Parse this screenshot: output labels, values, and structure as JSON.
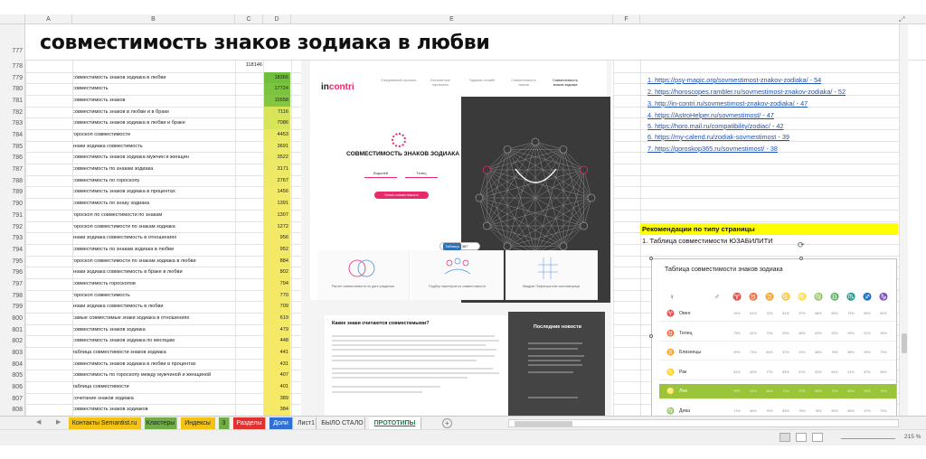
{
  "columns": [
    "A",
    "B",
    "C",
    "D",
    "E",
    "F"
  ],
  "title_row": {
    "num": "777",
    "title": "совместимость знаков зодиака в любви"
  },
  "total": "118146",
  "rows": [
    {
      "n": "778",
      "kw": "",
      "v": "",
      "c": ""
    },
    {
      "n": "779",
      "kw": "совместимость знаков зодиака в любви",
      "v": "18366",
      "c": "#6fbf3c"
    },
    {
      "n": "780",
      "kw": "совместимость",
      "v": "17724",
      "c": "#7cc33f"
    },
    {
      "n": "781",
      "kw": "совместимость знаков",
      "v": "15558",
      "c": "#84c642"
    },
    {
      "n": "782",
      "kw": "совместимость знаков в любви и в браке",
      "v": "7116",
      "c": "#d8e45a"
    },
    {
      "n": "783",
      "kw": "совместимость знаков зодиака в любви и браке",
      "v": "7086",
      "c": "#d8e45a"
    },
    {
      "n": "784",
      "kw": "гороскоп совместимости",
      "v": "4453",
      "c": "#e8e862"
    },
    {
      "n": "785",
      "kw": "знаки зодиака совместимость",
      "v": "3691",
      "c": "#ebe966"
    },
    {
      "n": "786",
      "kw": "совместимость знаков зодиака мужчин и женщин",
      "v": "3522",
      "c": "#ece966"
    },
    {
      "n": "787",
      "kw": "совместимость по знакам зодиака",
      "v": "3171",
      "c": "#ede966"
    },
    {
      "n": "788",
      "kw": "совместимость по гороскопу",
      "v": "2767",
      "c": "#eee966"
    },
    {
      "n": "789",
      "kw": "совместимость знаков зодиака в процентах",
      "v": "1456",
      "c": "#f1e967"
    },
    {
      "n": "790",
      "kw": "совместимость по знаку зодиака",
      "v": "1391",
      "c": "#f2e967"
    },
    {
      "n": "791",
      "kw": "гороскоп по совместимости по знакам",
      "v": "1307",
      "c": "#f2e967"
    },
    {
      "n": "792",
      "kw": "гороскоп совместимости по знакам зодиака",
      "v": "1272",
      "c": "#f2e967"
    },
    {
      "n": "793",
      "kw": "знаки зодиака совместимость в отношениях",
      "v": "956",
      "c": "#f3e967"
    },
    {
      "n": "794",
      "kw": "совместимость по знакам зодиака в любви",
      "v": "952",
      "c": "#f3e967"
    },
    {
      "n": "795",
      "kw": "гороскоп совместимости по знакам зодиака в любви",
      "v": "884",
      "c": "#f3e967"
    },
    {
      "n": "796",
      "kw": "знаки зодиака совместимость в браке в любви",
      "v": "802",
      "c": "#f4e967"
    },
    {
      "n": "797",
      "kw": "совместимость гороскопов",
      "v": "794",
      "c": "#f4e967"
    },
    {
      "n": "798",
      "kw": "гороскоп совместимость",
      "v": "770",
      "c": "#f4e967"
    },
    {
      "n": "799",
      "kw": "знаки зодиака совместимость в любви",
      "v": "709",
      "c": "#f4e967"
    },
    {
      "n": "800",
      "kw": "самые совместимые знаки зодиака в отношениях",
      "v": "619",
      "c": "#f4e967"
    },
    {
      "n": "801",
      "kw": "совместимость знаков зодиака",
      "v": "479",
      "c": "#f5e967"
    },
    {
      "n": "802",
      "kw": "совместимость знаков зодиака по месяцам",
      "v": "448",
      "c": "#f5e967"
    },
    {
      "n": "803",
      "kw": "таблица совместимости знаков зодиака",
      "v": "441",
      "c": "#f5e967"
    },
    {
      "n": "804",
      "kw": "совместимость знаков зодиака в любви в процентах",
      "v": "431",
      "c": "#f5e967"
    },
    {
      "n": "805",
      "kw": "совместимость по гороскопу между мужчиной и женщиной",
      "v": "407",
      "c": "#f5e967"
    },
    {
      "n": "806",
      "kw": "таблица совместимости",
      "v": "401",
      "c": "#f5e967"
    },
    {
      "n": "807",
      "kw": "сочетание знаков зодиака",
      "v": "389",
      "c": "#f5e967"
    },
    {
      "n": "808",
      "kw": "совместимость знаков зодиаков",
      "v": "384",
      "c": "#f5e967"
    }
  ],
  "links": [
    "1. https://psy-magic.org/sovmestimost-znakov-zodiaka/ - 54",
    "2. https://horoscopes.rambler.ru/sovmestimost-znakov-zodiaka/ - 52",
    "3. http://in-contri.ru/sovmestimost-znakov-zodiaka/ - 47",
    "4. https://AstroHelper.ru/sovmestimost/ - 47",
    "5. https://horo.mail.ru/compatibility/zodiac/ - 42",
    "6. https://my-calend.ru/zodiak-sovmestimost - 39",
    "7. https://goroskop365.ru/sovmestimost/ - 38"
  ],
  "recommendations": {
    "title": "Рекомендации по типу страницы",
    "item1": "1. Таблица совместимости ЮЗАБИЛИТИ"
  },
  "prototype": {
    "logo_a": "in",
    "logo_b": "contri",
    "nav": [
      "Ежедневный гороскоп",
      "Бесплатные гороскопы",
      "Гадания онлайн",
      "Совместимость знаков",
      "Совместимость знаков зодиака"
    ],
    "compat_title": "СОВМЕСТИМОСТЬ ЗНАКОВ ЗОДИАКА",
    "sign_left": "Водолей",
    "sign_right": "Телец",
    "calc_button": "Узнать совместимость",
    "badge_tag": "Таблица",
    "badge_num": "387",
    "features": [
      "Расчет совместимости по дате рождения",
      "Подбор партнеров по совместимости",
      "Квадрат Пифагора или психоматрица"
    ],
    "article_title": "Какие знаки считаются совместимыми?",
    "news_title": "Последние новости"
  },
  "compat_table": {
    "title": "Таблица совместимости знаков зодиака",
    "header_icons": [
      "♀",
      "♂",
      "♈",
      "♉",
      "♊",
      "♋",
      "♌",
      "♍",
      "♎",
      "♏",
      "♐",
      "♑"
    ],
    "rows": [
      {
        "sign": "♈",
        "name": "Овен",
        "pcts": [
          "91%",
          "81%",
          "72%",
          "81%",
          "97%",
          "68%",
          "83%",
          "75%",
          "90%",
          "82%"
        ]
      },
      {
        "sign": "♉",
        "name": "Телец",
        "pcts": [
          "73%",
          "81%",
          "73%",
          "53%",
          "68%",
          "82%",
          "93%",
          "99%",
          "91%",
          "95%"
        ]
      },
      {
        "sign": "♊",
        "name": "Близнецы",
        "pcts": [
          "90%",
          "73%",
          "84%",
          "67%",
          "91%",
          "68%",
          "79%",
          "58%",
          "93%",
          "73%"
        ]
      },
      {
        "sign": "♋",
        "name": "Рак",
        "pcts": [
          "81%",
          "60%",
          "77%",
          "83%",
          "67%",
          "82%",
          "64%",
          "91%",
          "87%",
          "95%"
        ]
      },
      {
        "sign": "♌",
        "name": "Лев",
        "pcts": [
          "99%",
          "81%",
          "68%",
          "71%",
          "57%",
          "88%",
          "79%",
          "88%",
          "99%",
          "76%"
        ]
      },
      {
        "sign": "♍",
        "name": "Дева",
        "pcts": [
          "71%",
          "80%",
          "79%",
          "83%",
          "75%",
          "78%",
          "90%",
          "85%",
          "97%",
          "73%"
        ]
      }
    ]
  },
  "sheet_tabs": [
    {
      "label": "Контакты Semantist.ru",
      "bg": "#f2c314",
      "fg": "#222"
    },
    {
      "label": "Кластеры",
      "bg": "#70ad47",
      "fg": "#222"
    },
    {
      "label": "Индексы",
      "bg": "#f2c314",
      "fg": "#222"
    },
    {
      "label": "3",
      "bg": "#70ad47",
      "fg": "#222"
    },
    {
      "label": "Разделы",
      "bg": "#e03131",
      "fg": "#fff"
    },
    {
      "label": "Доли",
      "bg": "#2f6fd6",
      "fg": "#fff"
    },
    {
      "label": "Лист1",
      "bg": "#f0f0f0",
      "fg": "#333"
    },
    {
      "label": "БЫЛО СТАЛО",
      "bg": "#f0f0f0",
      "fg": "#333"
    },
    {
      "label": "ПРОТОТИПЫ",
      "bg": "#ffffff",
      "fg": "#1b7a4a"
    }
  ],
  "nav_prev": "◀",
  "nav_next": "▶",
  "add_sheet": "+",
  "zoom_label": "215 %",
  "icons": {
    "fullscreen": "fullscreen-icon",
    "rotate": "rotate-icon"
  }
}
